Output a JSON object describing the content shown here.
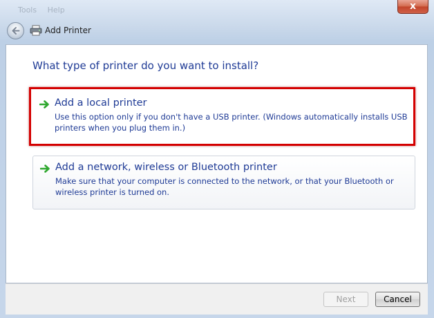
{
  "window": {
    "title": "Add Printer",
    "menu_ghost": [
      "Tools",
      "Help"
    ],
    "close_glyph": "x"
  },
  "main": {
    "heading": "What type of printer do you want to install?",
    "options": [
      {
        "title": "Add a local printer",
        "description": "Use this option only if you don't have a USB printer. (Windows automatically installs USB printers when you plug them in.)",
        "highlighted": true
      },
      {
        "title": "Add a network, wireless or Bluetooth printer",
        "description": "Make sure that your computer is connected to the network, or that your Bluetooth or wireless printer is turned on.",
        "highlighted": false
      }
    ]
  },
  "footer": {
    "next_label": "Next",
    "cancel_label": "Cancel",
    "next_enabled": false
  },
  "icons": {
    "back": "back-arrow-icon",
    "printer": "printer-icon",
    "option_arrow": "green-arrow-icon"
  },
  "colors": {
    "heading_text": "#1e3a95",
    "highlight_border": "#d40000",
    "arrow_green": "#2fa82f"
  }
}
